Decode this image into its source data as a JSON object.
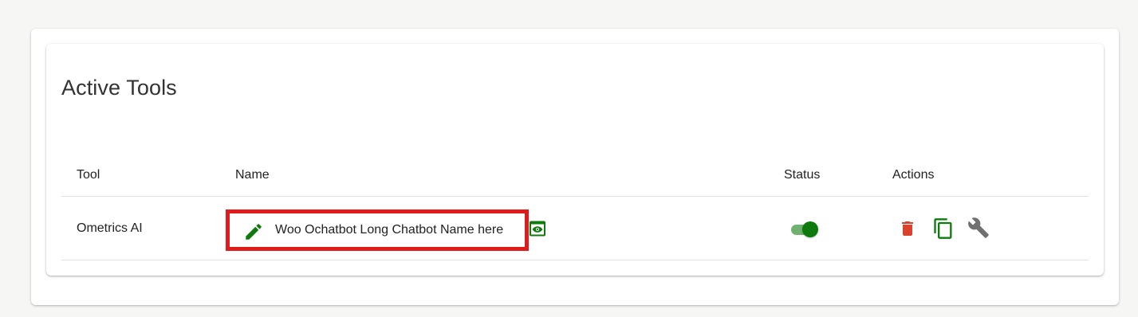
{
  "page": {
    "title": "Active Tools"
  },
  "table": {
    "headers": {
      "tool": "Tool",
      "name": "Name",
      "status": "Status",
      "actions": "Actions"
    },
    "rows": [
      {
        "tool": "Ometrics AI",
        "name": "Woo Ochatbot Long Chatbot Name here",
        "status_enabled": true,
        "icons": {
          "edit": "pencil-icon",
          "preview": "eye-icon",
          "delete": "trash-icon",
          "copy": "copy-icon",
          "settings": "wrench-icon"
        }
      }
    ]
  },
  "colors": {
    "accent_green": "#0e7a0e",
    "switch_track": "#6fb26f",
    "delete_red": "#d9432e",
    "wrench_grey": "#707070",
    "highlight_red": "#e01b1b"
  }
}
